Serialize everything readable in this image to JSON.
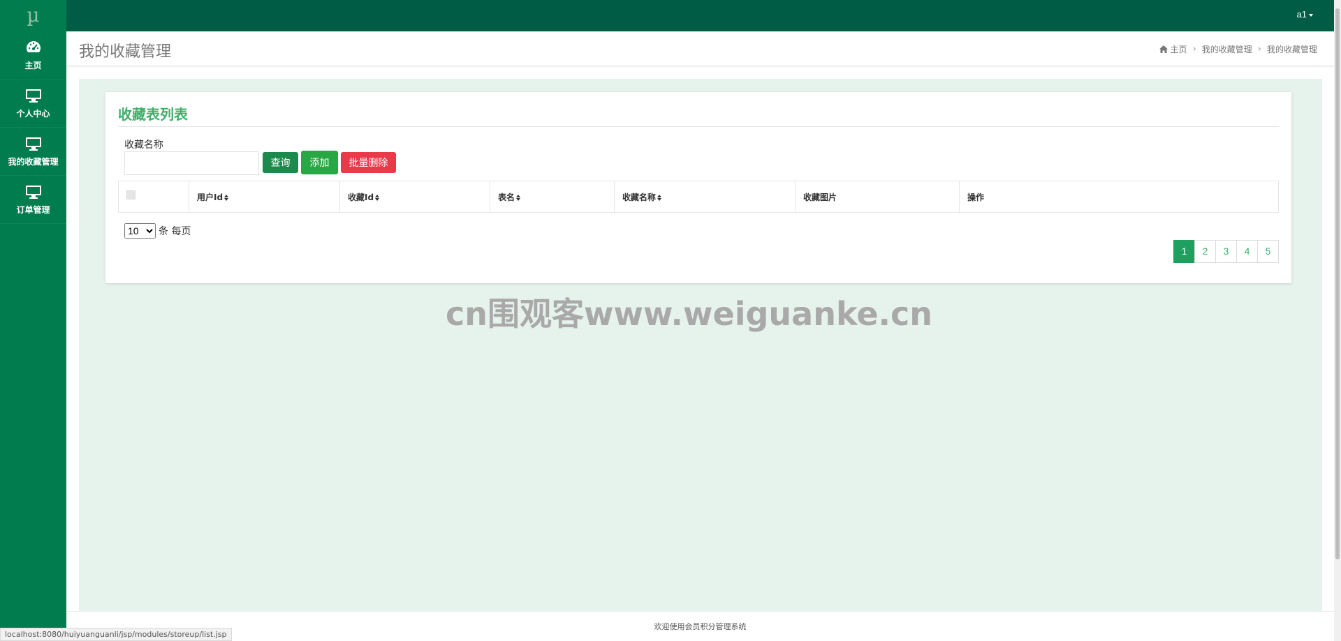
{
  "brand": {
    "logo": "µ"
  },
  "topbar": {
    "user": "a1"
  },
  "sidebar": {
    "items": [
      {
        "label": "主页",
        "icon": "dashboard-icon"
      },
      {
        "label": "个人中心",
        "icon": "monitor-icon"
      },
      {
        "label": "我的收藏管理",
        "icon": "monitor-icon"
      },
      {
        "label": "订单管理",
        "icon": "monitor-icon"
      }
    ]
  },
  "header": {
    "title": "我的收藏管理",
    "breadcrumb": [
      "主页",
      "我的收藏管理",
      "我的收藏管理"
    ]
  },
  "card": {
    "title": "收藏表列表",
    "search": {
      "label": "收藏名称",
      "value": "",
      "placeholder": ""
    },
    "buttons": {
      "query": "查询",
      "add": "添加",
      "batch_delete": "批量删除"
    },
    "table": {
      "columns": [
        "用户Id",
        "收藏Id",
        "表名",
        "收藏名称",
        "收藏图片",
        "操作"
      ],
      "rows": []
    },
    "page_size": {
      "value": "10",
      "suffix": "条 每页"
    },
    "pages": [
      "1",
      "2",
      "3",
      "4",
      "5"
    ],
    "current_page": "1"
  },
  "watermark": "cn围观客www.weiguanke.cn",
  "footer": {
    "text": "欢迎使用会员积分管理系统"
  },
  "status_bar": {
    "url": "localhost:8080/huiyuanguanli/jsp/modules/storeup/list.jsp"
  },
  "colors": {
    "topbar": "#005c44",
    "sidebar": "#007c4f",
    "accent": "#3fae6a",
    "danger": "#ea3a4a",
    "content_bg": "#e6f2ec"
  }
}
